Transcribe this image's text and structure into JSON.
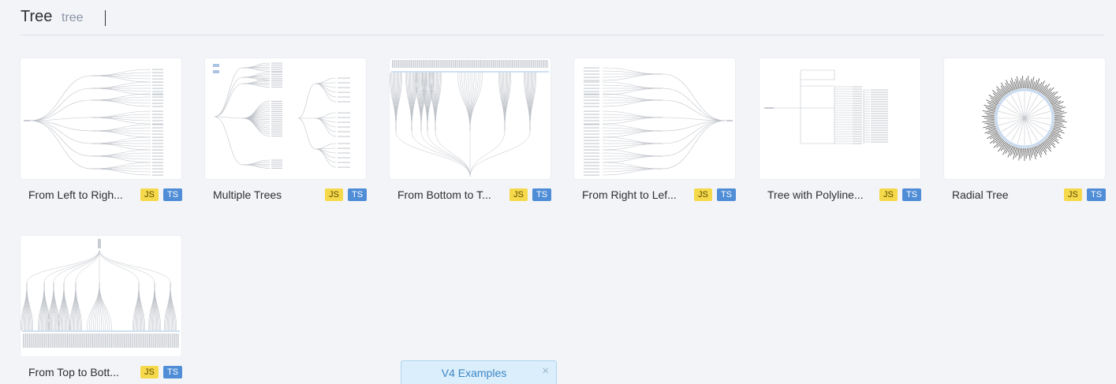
{
  "header": {
    "title": "Tree",
    "search_value": "tree"
  },
  "cards": [
    {
      "title": "From Left to Righ...",
      "js": "JS",
      "ts": "TS"
    },
    {
      "title": "Multiple Trees",
      "js": "JS",
      "ts": "TS"
    },
    {
      "title": "From Bottom to T...",
      "js": "JS",
      "ts": "TS"
    },
    {
      "title": "From Right to Lef...",
      "js": "JS",
      "ts": "TS"
    },
    {
      "title": "Tree with Polyline...",
      "js": "JS",
      "ts": "TS"
    },
    {
      "title": "Radial Tree",
      "js": "JS",
      "ts": "TS"
    },
    {
      "title": "From Top to Bott...",
      "js": "JS",
      "ts": "TS"
    }
  ],
  "banner": {
    "label": "V4 Examples",
    "close_glyph": "×"
  },
  "colors": {
    "background": "#f3f4f8",
    "js_badge": "#f6d94b",
    "ts_badge": "#4f8dd6",
    "banner_bg": "#dbeefb",
    "banner_text": "#3d87c6"
  }
}
